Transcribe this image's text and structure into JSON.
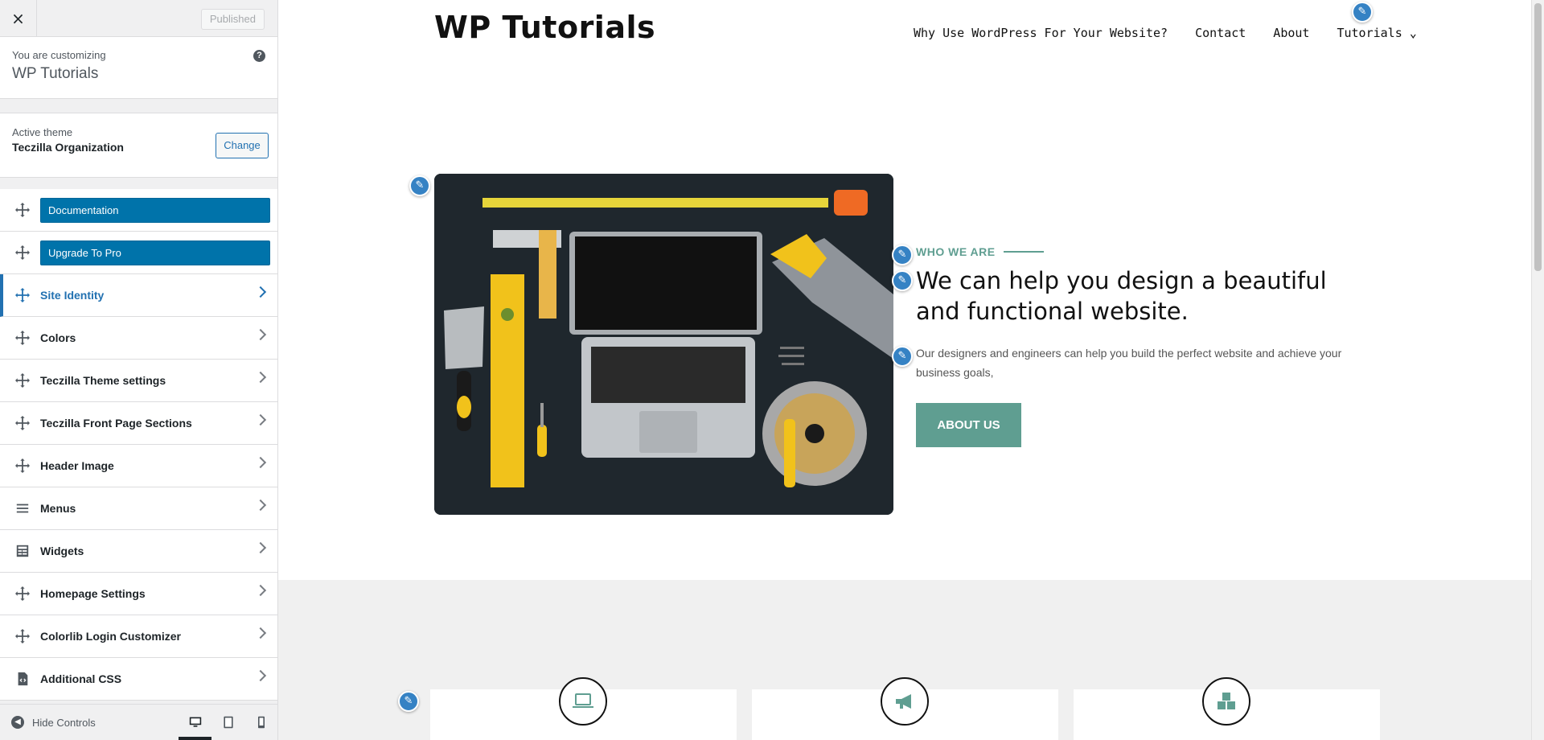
{
  "customizer": {
    "close_label": "×",
    "publish_label": "Published",
    "customizing_label": "You are customizing",
    "site_name": "WP Tutorials",
    "help_label": "?",
    "active_theme_label": "Active theme",
    "theme_name": "Teczilla Organization",
    "change_label": "Change",
    "buttons": [
      {
        "label": "Documentation"
      },
      {
        "label": "Upgrade To Pro"
      }
    ],
    "sections": [
      {
        "label": "Site Identity",
        "icon": "move-icon"
      },
      {
        "label": "Colors",
        "icon": "move-icon"
      },
      {
        "label": "Teczilla Theme settings",
        "icon": "move-icon"
      },
      {
        "label": "Teczilla Front Page Sections",
        "icon": "move-icon"
      },
      {
        "label": "Header Image",
        "icon": "move-icon"
      },
      {
        "label": "Menus",
        "icon": "menu-icon"
      },
      {
        "label": "Widgets",
        "icon": "widgets-icon"
      },
      {
        "label": "Homepage Settings",
        "icon": "move-icon"
      },
      {
        "label": "Colorlib Login Customizer",
        "icon": "move-icon"
      },
      {
        "label": "Additional CSS",
        "icon": "css-icon"
      }
    ],
    "hide_controls_label": "Hide Controls"
  },
  "site": {
    "title": "WP Tutorials",
    "nav": [
      "Why Use WordPress For Your Website?",
      "Contact",
      "About",
      "Tutorials"
    ],
    "hero": {
      "eyebrow": "WHO WE ARE",
      "headline": "We can help you design a beautiful and functional website.",
      "text": "Our designers and engineers can help you build the perfect website and achieve your business goals,",
      "button": "ABOUT US"
    }
  },
  "colors": {
    "accent": "#5f9e91",
    "wp_blue": "#2271b1",
    "button_blue": "#0073aa"
  }
}
